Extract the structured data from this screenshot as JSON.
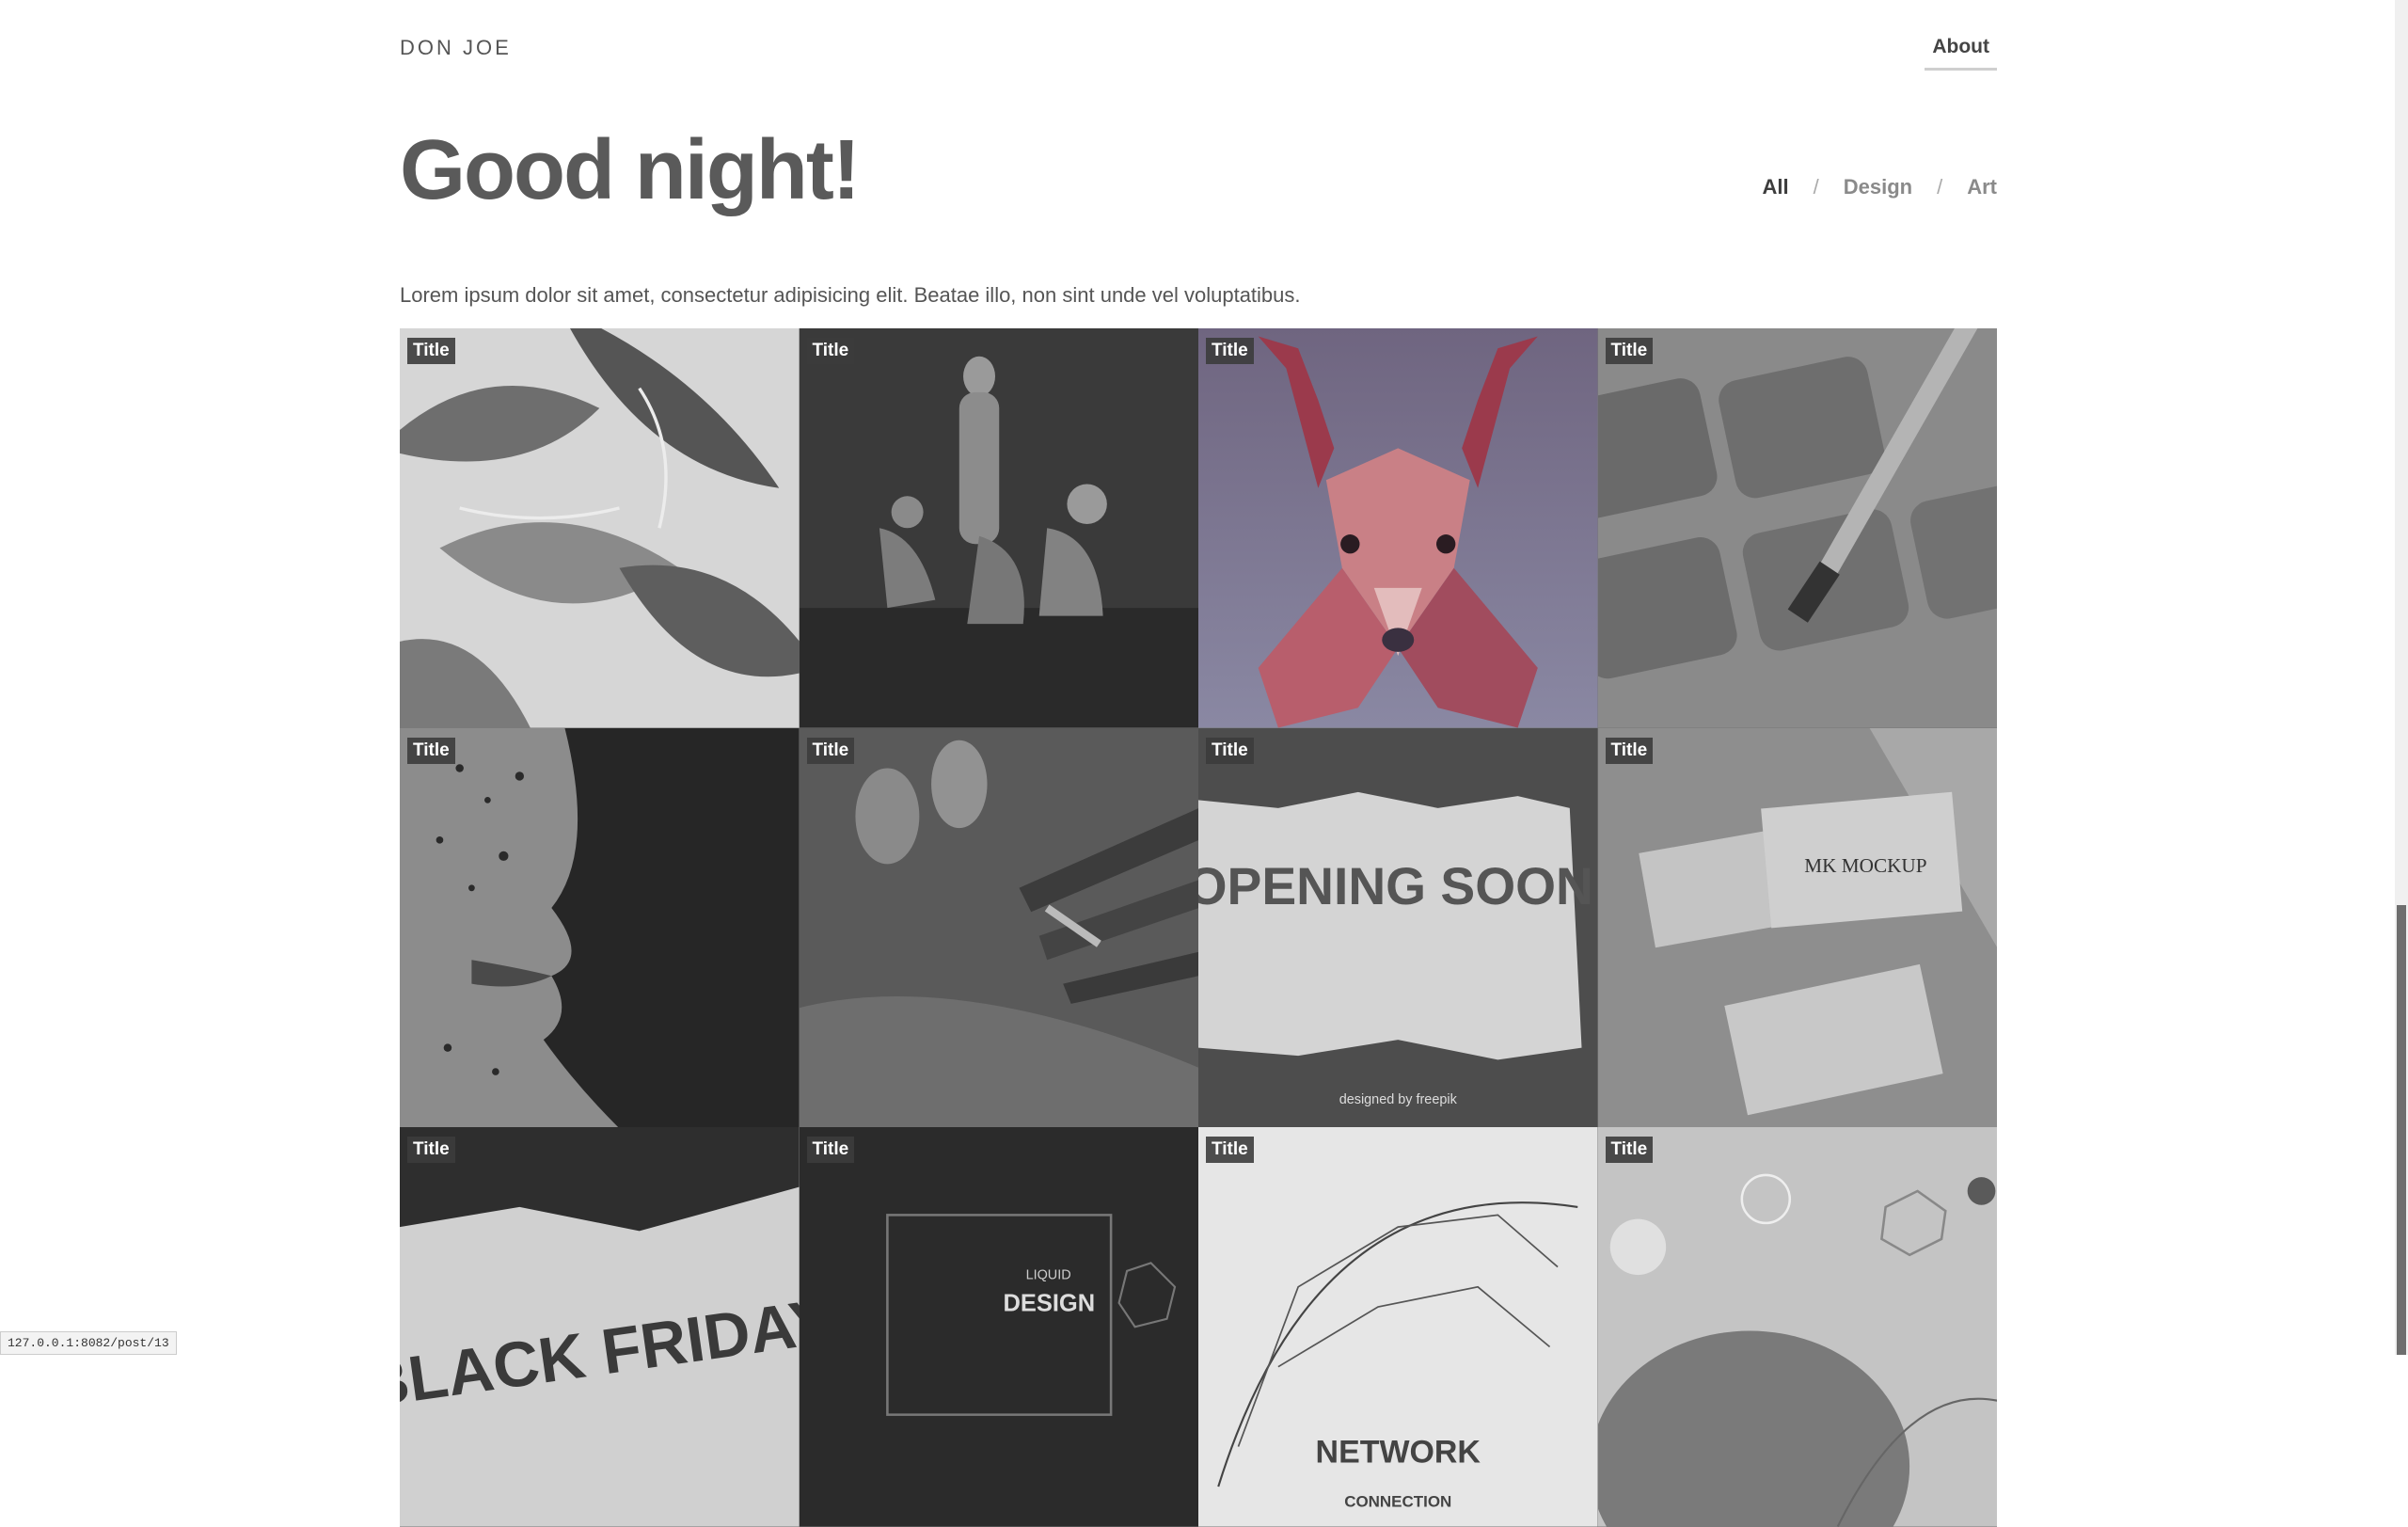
{
  "site": {
    "brand": "DON JOE",
    "about_label": "About"
  },
  "hero": {
    "title": "Good night!",
    "intro": "Lorem ipsum dolor sit amet, consectetur adipisicing elit. Beatae illo, non sint unde vel voluptatibus."
  },
  "filters": {
    "items": [
      "All",
      "Design",
      "Art"
    ],
    "separator": "/",
    "active": "All"
  },
  "tiles": [
    {
      "title": "Title",
      "label": "",
      "sublabel": ""
    },
    {
      "title": "Title",
      "label": "",
      "sublabel": ""
    },
    {
      "title": "Title",
      "label": "",
      "sublabel": ""
    },
    {
      "title": "Title",
      "label": "",
      "sublabel": ""
    },
    {
      "title": "Title",
      "label": "",
      "sublabel": ""
    },
    {
      "title": "Title",
      "label": "",
      "sublabel": ""
    },
    {
      "title": "Title",
      "label": "OPENING SOON",
      "sublabel": "designed by freepik"
    },
    {
      "title": "Title",
      "label": "MK MOCKUP",
      "sublabel": ""
    },
    {
      "title": "Title",
      "label": "BLACK FRIDAY",
      "sublabel": ""
    },
    {
      "title": "Title",
      "label": "DESIGN",
      "sublabel": "LIQUID"
    },
    {
      "title": "Title",
      "label": "NETWORK",
      "sublabel": "CONNECTION"
    },
    {
      "title": "Title",
      "label": "",
      "sublabel": ""
    }
  ],
  "status_bar": {
    "url": "127.0.0.1:8082/post/13"
  }
}
